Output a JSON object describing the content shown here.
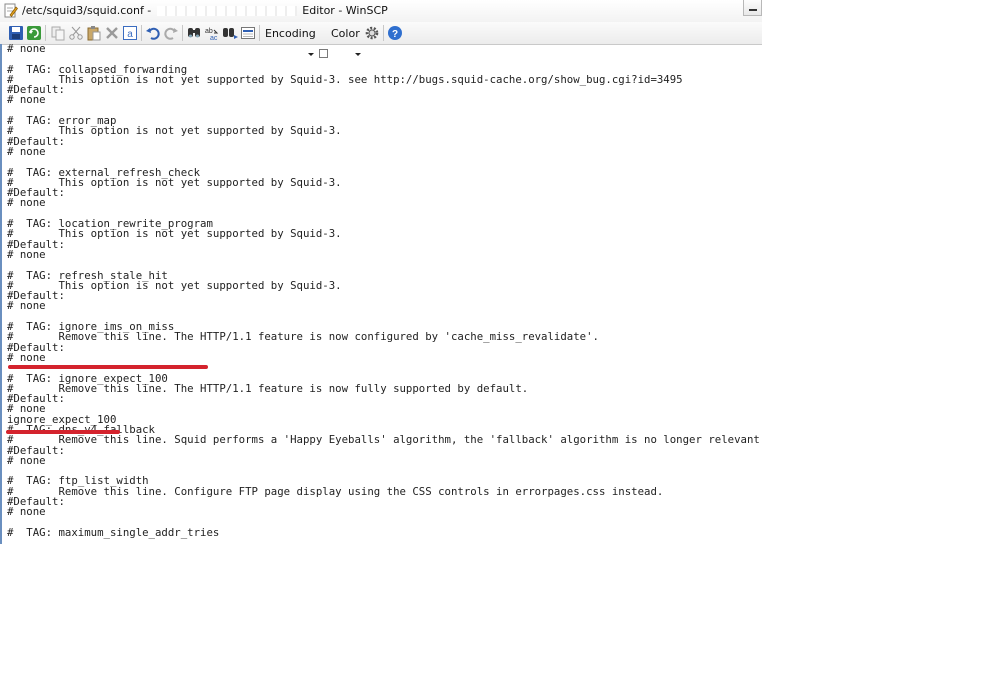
{
  "window": {
    "title_prefix": "/etc/squid3/squid.conf - ",
    "title_suffix": " Editor - WinSCP"
  },
  "toolbar": {
    "encoding_label": "Encoding",
    "color_label": "Color",
    "color_checked": false,
    "icons": [
      "save-icon",
      "reload-icon",
      "copy-icon",
      "cut-icon",
      "paste-icon",
      "delete-icon",
      "select-all-icon",
      "undo-icon",
      "redo-icon",
      "find-icon",
      "replace-icon",
      "find-next-icon",
      "goto-line-icon",
      "settings-icon",
      "help-icon"
    ]
  },
  "editor": {
    "lines": [
      "# none",
      "",
      "#  TAG: collapsed_forwarding",
      "#       This option is not yet supported by Squid-3. see http://bugs.squid-cache.org/show_bug.cgi?id=3495",
      "#Default:",
      "# none",
      "",
      "#  TAG: error_map",
      "#       This option is not yet supported by Squid-3.",
      "#Default:",
      "# none",
      "",
      "#  TAG: external_refresh_check",
      "#       This option is not yet supported by Squid-3.",
      "#Default:",
      "# none",
      "",
      "#  TAG: location_rewrite_program",
      "#       This option is not yet supported by Squid-3.",
      "#Default:",
      "# none",
      "",
      "#  TAG: refresh_stale_hit",
      "#       This option is not yet supported by Squid-3.",
      "#Default:",
      "# none",
      "",
      "#  TAG: ignore_ims_on_miss",
      "#       Remove this line. The HTTP/1.1 feature is now configured by 'cache_miss_revalidate'.",
      "#Default:",
      "# none",
      "",
      "#  TAG: ignore_expect_100",
      "#       Remove this line. The HTTP/1.1 feature is now fully supported by default.",
      "#Default:",
      "# none",
      "ignore_expect_100",
      "#  TAG: dns_v4_fallback",
      "#       Remove this line. Squid performs a 'Happy Eyeballs' algorithm, the 'fallback' algorithm is no longer relevant.",
      "#Default:",
      "# none",
      "",
      "#  TAG: ftp_list_width",
      "#       Remove this line. Configure FTP page display using the CSS controls in errorpages.css instead.",
      "#Default:",
      "# none",
      "",
      "#  TAG: maximum_single_addr_tries"
    ],
    "annotations": {
      "underline_color": "#d4232d"
    }
  }
}
